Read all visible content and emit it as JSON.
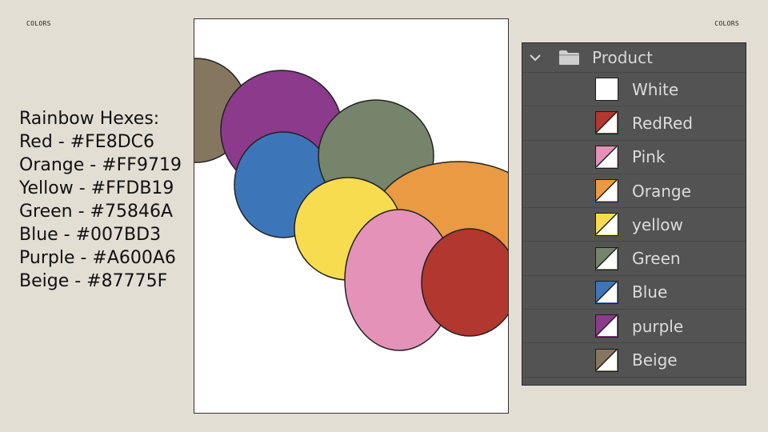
{
  "slide": {
    "corner_left": "COLORS",
    "corner_right": "COLORS"
  },
  "hex_list": {
    "title": "Rainbow Hexes:",
    "items": [
      "Red - #FE8DC6",
      "Orange - #FF9719",
      "Yellow - #FFDB19",
      "Green - #75846A",
      "Blue - #007BD3",
      "Purple - #A600A6",
      "Beige - #87775F"
    ]
  },
  "canvas": {
    "shapes": [
      {
        "name": "beige-circle",
        "fill": "#85775f"
      },
      {
        "name": "purple-circle",
        "fill": "#8c3a8c"
      },
      {
        "name": "blue-circle",
        "fill": "#3d76b8"
      },
      {
        "name": "green-circle",
        "fill": "#75846a"
      },
      {
        "name": "orange-circle",
        "fill": "#e99a42"
      },
      {
        "name": "yellow-circle",
        "fill": "#f8dc4f"
      },
      {
        "name": "pink-circle",
        "fill": "#e492b8"
      },
      {
        "name": "red-circle",
        "fill": "#b1372f"
      }
    ]
  },
  "layers_panel": {
    "group_name": "Product",
    "folder_icon": "folder-icon",
    "expand_icon": "chevron-down-icon",
    "layers": [
      {
        "label": "White",
        "color": "#ffffff"
      },
      {
        "label": "RedRed",
        "color": "#b1372f"
      },
      {
        "label": "Pink",
        "color": "#e492b8"
      },
      {
        "label": "Orange",
        "color": "#e99a42"
      },
      {
        "label": "yellow",
        "color": "#f8dc4f"
      },
      {
        "label": "Green",
        "color": "#75846a"
      },
      {
        "label": "Blue",
        "color": "#3d76b8"
      },
      {
        "label": "purple",
        "color": "#8c3a8c"
      },
      {
        "label": "Beige",
        "color": "#85775f"
      }
    ]
  }
}
